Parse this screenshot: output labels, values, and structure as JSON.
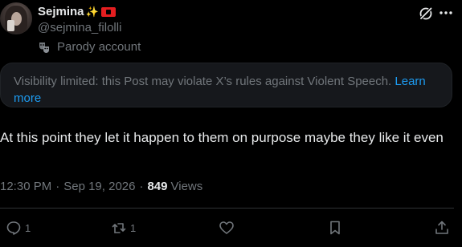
{
  "author": {
    "display_name": "Sejmina",
    "name_emoji": "✨",
    "flag_icon": "albania-flag-icon",
    "handle": "@sejmina_filolli",
    "label": "Parody account",
    "label_icon": "theater-masks-icon"
  },
  "header_icons": {
    "grok": "grok-icon",
    "more": "more-icon"
  },
  "notice": {
    "text": "Visibility limited: this Post may violate X’s rules against Violent Speech.",
    "link": "Learn more"
  },
  "post": {
    "text": "At this point they let it happen to them on purpose maybe they like it even"
  },
  "meta": {
    "time": "12:30 PM",
    "separator": "·",
    "date": "Sep 19, 2026",
    "views_count": "849",
    "views_label": "Views"
  },
  "actions": {
    "reply_count": "1",
    "repost_count": "1"
  },
  "colors": {
    "background": "#000000",
    "text": "#e7e9ea",
    "muted": "#71767b",
    "accent": "#1d9bf0",
    "notice_bg": "#16181c",
    "flag_red": "#e41e20"
  }
}
